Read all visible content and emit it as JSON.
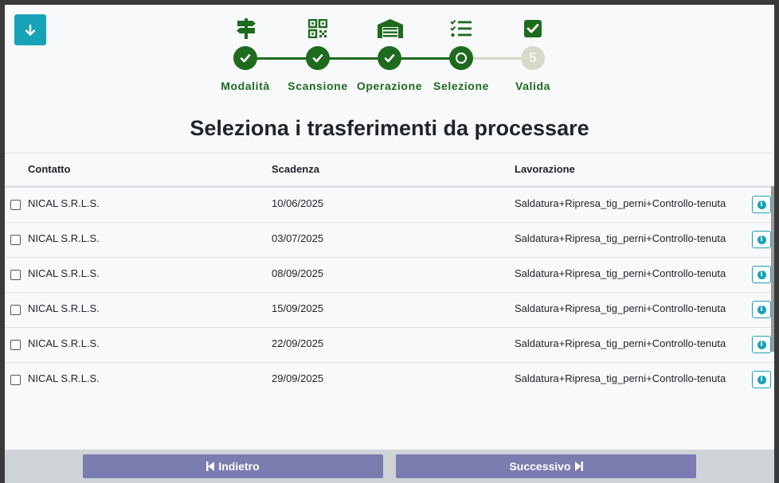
{
  "toolbar": {
    "download_icon": "arrow-down-icon"
  },
  "stepper": {
    "steps": [
      {
        "label": "Modalità",
        "icon": "signpost-icon",
        "state": "done"
      },
      {
        "label": "Scansione",
        "icon": "qrcode-icon",
        "state": "done"
      },
      {
        "label": "Operazione",
        "icon": "warehouse-icon",
        "state": "done"
      },
      {
        "label": "Selezione",
        "icon": "tasks-icon",
        "state": "current"
      },
      {
        "label": "Valida",
        "icon": "check-square-icon",
        "state": "todo",
        "number": "5"
      }
    ],
    "colors": {
      "active": "#1e6b1e",
      "inactive": "#d8d8c8"
    }
  },
  "page": {
    "title": "Seleziona i trasferimenti da processare"
  },
  "table": {
    "headers": {
      "contact": "Contatto",
      "due": "Scadenza",
      "work": "Lavorazione"
    },
    "rows": [
      {
        "contact": "NICAL S.R.L.S.",
        "due": "10/06/2025",
        "work": "Saldatura+Ripresa_tig_perni+Controllo-tenuta"
      },
      {
        "contact": "NICAL S.R.L.S.",
        "due": "03/07/2025",
        "work": "Saldatura+Ripresa_tig_perni+Controllo-tenuta"
      },
      {
        "contact": "NICAL S.R.L.S.",
        "due": "08/09/2025",
        "work": "Saldatura+Ripresa_tig_perni+Controllo-tenuta"
      },
      {
        "contact": "NICAL S.R.L.S.",
        "due": "15/09/2025",
        "work": "Saldatura+Ripresa_tig_perni+Controllo-tenuta"
      },
      {
        "contact": "NICAL S.R.L.S.",
        "due": "22/09/2025",
        "work": "Saldatura+Ripresa_tig_perni+Controllo-tenuta"
      },
      {
        "contact": "NICAL S.R.L.S.",
        "due": "29/09/2025",
        "work": "Saldatura+Ripresa_tig_perni+Controllo-tenuta"
      }
    ]
  },
  "footer": {
    "back_label": "Indietro",
    "next_label": "Successivo"
  },
  "colors": {
    "accent": "#17a2b8",
    "footer_button": "#7b7cb0"
  }
}
